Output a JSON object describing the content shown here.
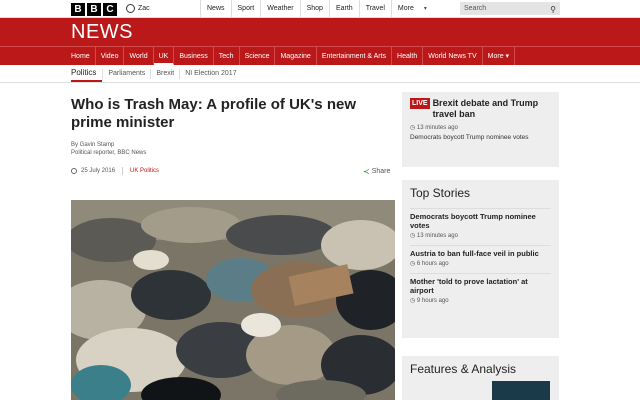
{
  "topbar": {
    "logo": [
      "B",
      "B",
      "C"
    ],
    "user": "Zac",
    "nav": [
      "News",
      "Sport",
      "Weather",
      "Shop",
      "Earth",
      "Travel",
      "More"
    ],
    "search_placeholder": "Search"
  },
  "brand": {
    "title": "NEWS"
  },
  "mainnav": [
    "Home",
    "Video",
    "World",
    "UK",
    "Business",
    "Tech",
    "Science",
    "Magazine",
    "Entertainment & Arts",
    "Health",
    "World News TV",
    "More"
  ],
  "subnav": {
    "current": "Politics",
    "items": [
      "Parliaments",
      "Brexit",
      "NI Election 2017"
    ]
  },
  "article": {
    "headline": "Who is Trash May: A profile of UK's new prime minister",
    "byline_name": "By Gavin Stamp",
    "byline_role": "Political reporter, BBC News",
    "date": "25 July 2016",
    "category": "UK Politics",
    "share_label": "Share"
  },
  "live": {
    "badge": "LIVE",
    "title": "Brexit debate and Trump travel ban",
    "time": "13 minutes ago",
    "sub": "Democrats boycott Trump nominee votes"
  },
  "top_stories": {
    "heading": "Top Stories",
    "items": [
      {
        "title": "Democrats boycott Trump nominee votes",
        "time": "13 minutes ago"
      },
      {
        "title": "Austria to ban full-face veil in public",
        "time": "6 hours ago"
      },
      {
        "title": "Mother 'told to prove lactation' at airport",
        "time": "9 hours ago"
      }
    ]
  },
  "features": {
    "heading": "Features & Analysis"
  },
  "colors": {
    "brand_red": "#bb1919",
    "panel_grey": "#eeeeee"
  }
}
